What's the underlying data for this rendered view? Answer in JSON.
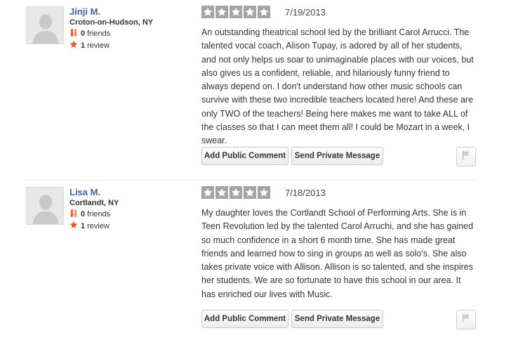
{
  "reviews": [
    {
      "user_name": "Jinji M.",
      "location": "Croton-on-Hudson, NY",
      "friends_count": "0",
      "friends_label": "friends",
      "review_count": "1",
      "review_label": "review",
      "rating": 5,
      "date": "7/19/2013",
      "text": "An outstanding theatrical school led by the brilliant Carol Arrucci. The talented vocal coach, Alison Tupay, is adored by all of her students, and not only helps us soar to unimaginable places with our voices, but also gives us a confident, reliable, and hilariously funny friend to always depend on. I don't understand how other music schools can survive with these two incredible teachers located here! And these are only TWO of the teachers! Being here makes me want to take ALL of the classes so that I can meet them all! I could be Mozart in a week, I swear."
    },
    {
      "user_name": "Lisa M.",
      "location": "Cortlandt, NY",
      "friends_count": "0",
      "friends_label": "friends",
      "review_count": "1",
      "review_label": "review",
      "rating": 5,
      "date": "7/18/2013",
      "text": "My daughter loves the Cortlandt School of Performing Arts.  She is in Teen Revolution led by the talented Carol Arruchi, and she has gained so much confidence in a short 6 month time.  She has made great friends and learned how to sing in groups as well as solo's.  She also takes private voice with Allison.  Allison is so talented, and she inspires her students.  We are so fortunate to have this school in our area.  It has enriched our lives with Music."
    }
  ],
  "buttons": {
    "add_comment": "Add Public Comment",
    "private_message": "Send Private Message"
  },
  "icons": {
    "friends": "friends-icon",
    "review": "star-icon",
    "flag": "flag-icon"
  },
  "colors": {
    "user_name": "#3b65a7",
    "star_box": "#a4a4a4",
    "review_star": "#e8542a"
  }
}
